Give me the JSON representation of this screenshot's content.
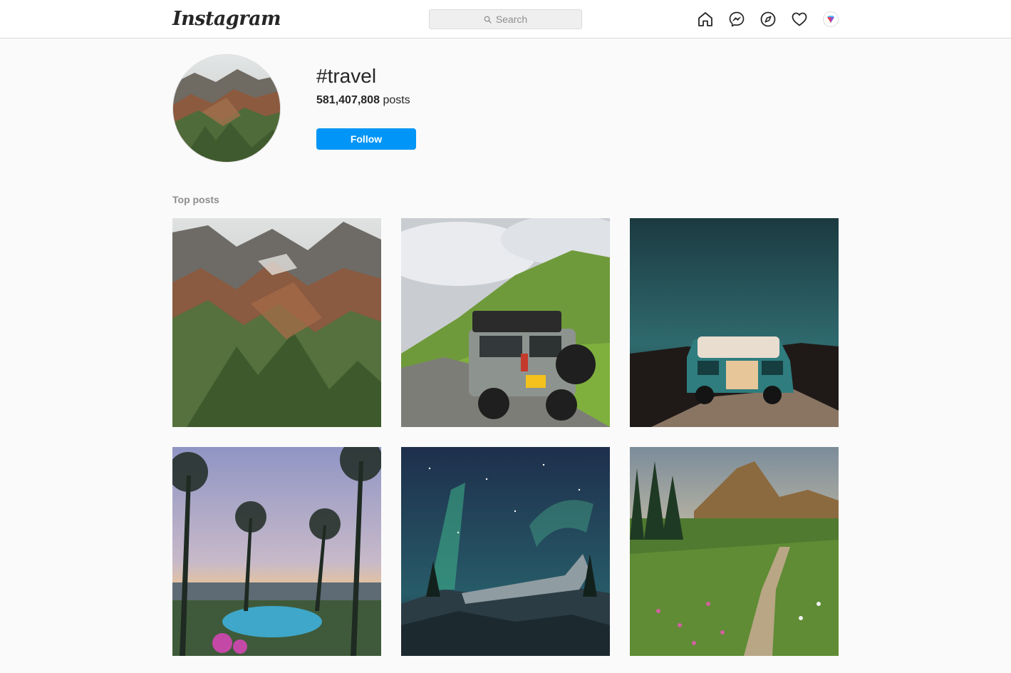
{
  "header": {
    "logo": "Instagram",
    "search_placeholder": "Search",
    "icons": [
      "home-icon",
      "messenger-icon",
      "explore-icon",
      "heart-icon",
      "profile-avatar"
    ]
  },
  "hashtag": {
    "title": "#travel",
    "post_count": "581,407,808",
    "post_count_suffix": "posts",
    "follow_label": "Follow"
  },
  "section": {
    "top_posts_label": "Top posts"
  },
  "posts": [
    {
      "subject": "colorful-mountains"
    },
    {
      "subject": "offroad-vehicle-hills"
    },
    {
      "subject": "camper-van-night"
    },
    {
      "subject": "palm-trees-sunset-pool"
    },
    {
      "subject": "aurora-plane-wreck"
    },
    {
      "subject": "mountain-meadow-trail"
    }
  ],
  "colors": {
    "accent": "#0095f6",
    "text": "#262626",
    "muted": "#8e8e8e",
    "border": "#dbdbdb",
    "background": "#fafafa"
  }
}
